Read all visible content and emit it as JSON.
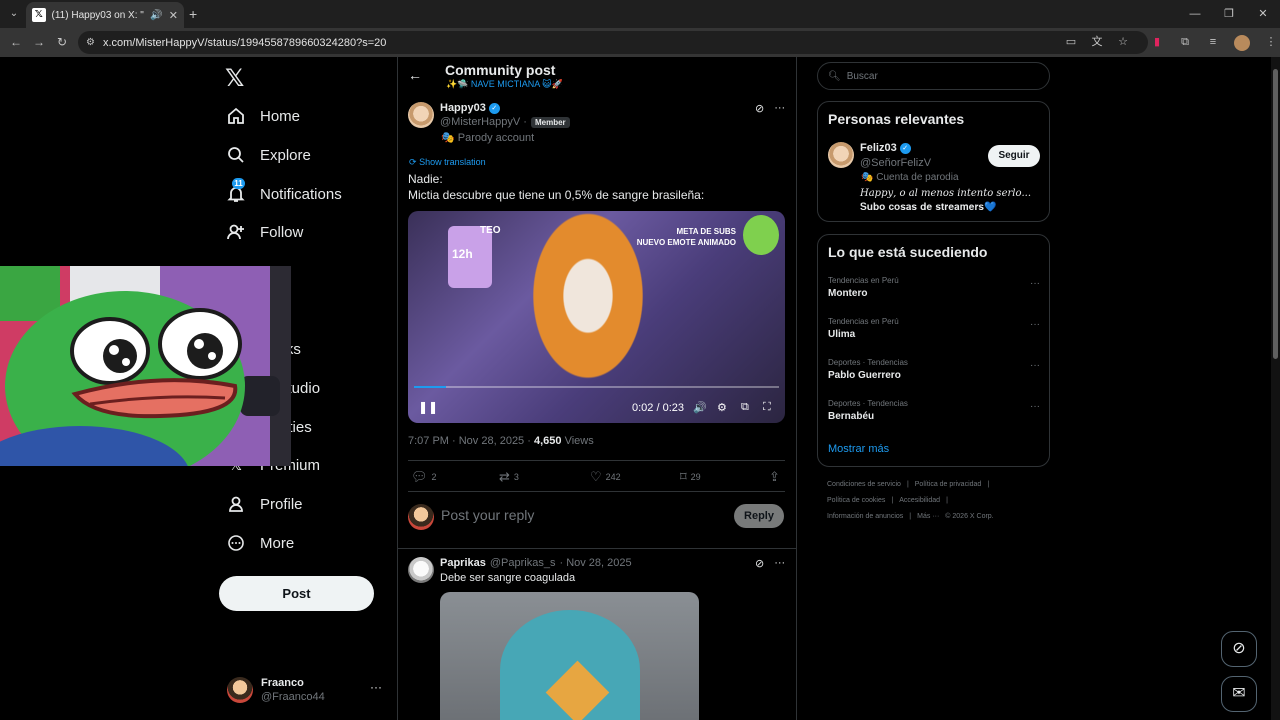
{
  "browser": {
    "tab_title": "(11) Happy03 on X: \"Nadie:",
    "url": "x.com/MisterHappyV/status/1994558789660324280?s=20"
  },
  "sidebar": {
    "items": [
      {
        "label": "Home",
        "icon": "home-icon"
      },
      {
        "label": "Explore",
        "icon": "search-icon"
      },
      {
        "label": "Notifications",
        "icon": "bell-icon",
        "badge": "11"
      },
      {
        "label": "Follow",
        "icon": "follow-icon"
      },
      {
        "label": "marks",
        "icon": "bookmark-icon"
      },
      {
        "label": "or Studio",
        "icon": "studio-icon"
      },
      {
        "label": "nunities",
        "icon": "communities-icon"
      },
      {
        "label": "Premium",
        "icon": "x-icon"
      },
      {
        "label": "Profile",
        "icon": "person-icon"
      },
      {
        "label": "More",
        "icon": "more-icon"
      }
    ],
    "post_button": "Post",
    "account": {
      "name": "Fraanco",
      "handle": "@Fraanco44"
    }
  },
  "post": {
    "page_title": "Community post",
    "community": "✨🛸 NAVE MICTIANA 😺🚀",
    "author_name": "Happy03",
    "author_handle": "@MisterHappyV ·",
    "member_label": "Member",
    "parody_label": "Parody account",
    "show_translation": "Show translation",
    "text_line1": "Nadie:",
    "text_line2": "Mictia descubre que tiene un 0,5% de sangre brasileña:",
    "video": {
      "time": "0:02 / 0:23",
      "progress": 0.087,
      "overlay_timer": "12h",
      "overlay_teo": "TEO",
      "overlay_meta": "META DE SUBS\nNUEVO EMOTE ANIMADO"
    },
    "timestamp": "7:07 PM · Nov 28, 2025 ·",
    "views_count": "4,650",
    "views_label": "Views",
    "actions": {
      "replies": "2",
      "reposts": "3",
      "likes": "242",
      "bookmarks": "29"
    },
    "reply_placeholder": "Post your reply",
    "reply_button": "Reply"
  },
  "comment": {
    "name": "Paprikas",
    "handle": "@Paprikas_s",
    "date": "· Nov 28, 2025",
    "text": "Debe ser sangre coagulada"
  },
  "right": {
    "search_placeholder": "Buscar",
    "relevant_title": "Personas relevantes",
    "relevant_person": {
      "name": "Feliz03",
      "handle": "@SeñorFelizV",
      "follow": "Seguir",
      "parody": "Cuenta de parodia",
      "bio1": "𝐻𝑎𝑝𝑝𝑦, 𝑜 𝑎𝑙 𝑚𝑒𝑛𝑜𝑠 𝑖𝑛𝑡𝑒𝑛𝑡𝑜 𝑠𝑒𝑟𝑙𝑜...",
      "bio2": "𝐒𝐮𝐛𝐨 𝐜𝐨𝐬𝐚𝐬 𝐝𝐞 𝐬𝐭𝐫𝐞𝐚𝐦𝐞𝐫𝐬💙"
    },
    "trends_title": "Lo que está sucediendo",
    "trends": [
      {
        "category": "Tendencias en Perú",
        "name": "Montero"
      },
      {
        "category": "Tendencias en Perú",
        "name": "Ulima"
      },
      {
        "category": "Deportes · Tendencias",
        "name": "Pablo Guerrero"
      },
      {
        "category": "Deportes · Tendencias",
        "name": "Bernabéu"
      }
    ],
    "show_more": "Mostrar más",
    "footer": {
      "terms": "Condiciones de servicio",
      "privacy": "Política de privacidad",
      "cookies": "Política de cookies",
      "accessibility": "Accesibilidad",
      "ads": "Información de anuncios",
      "more": "Más ···",
      "copyright": "© 2026 X Corp."
    }
  }
}
